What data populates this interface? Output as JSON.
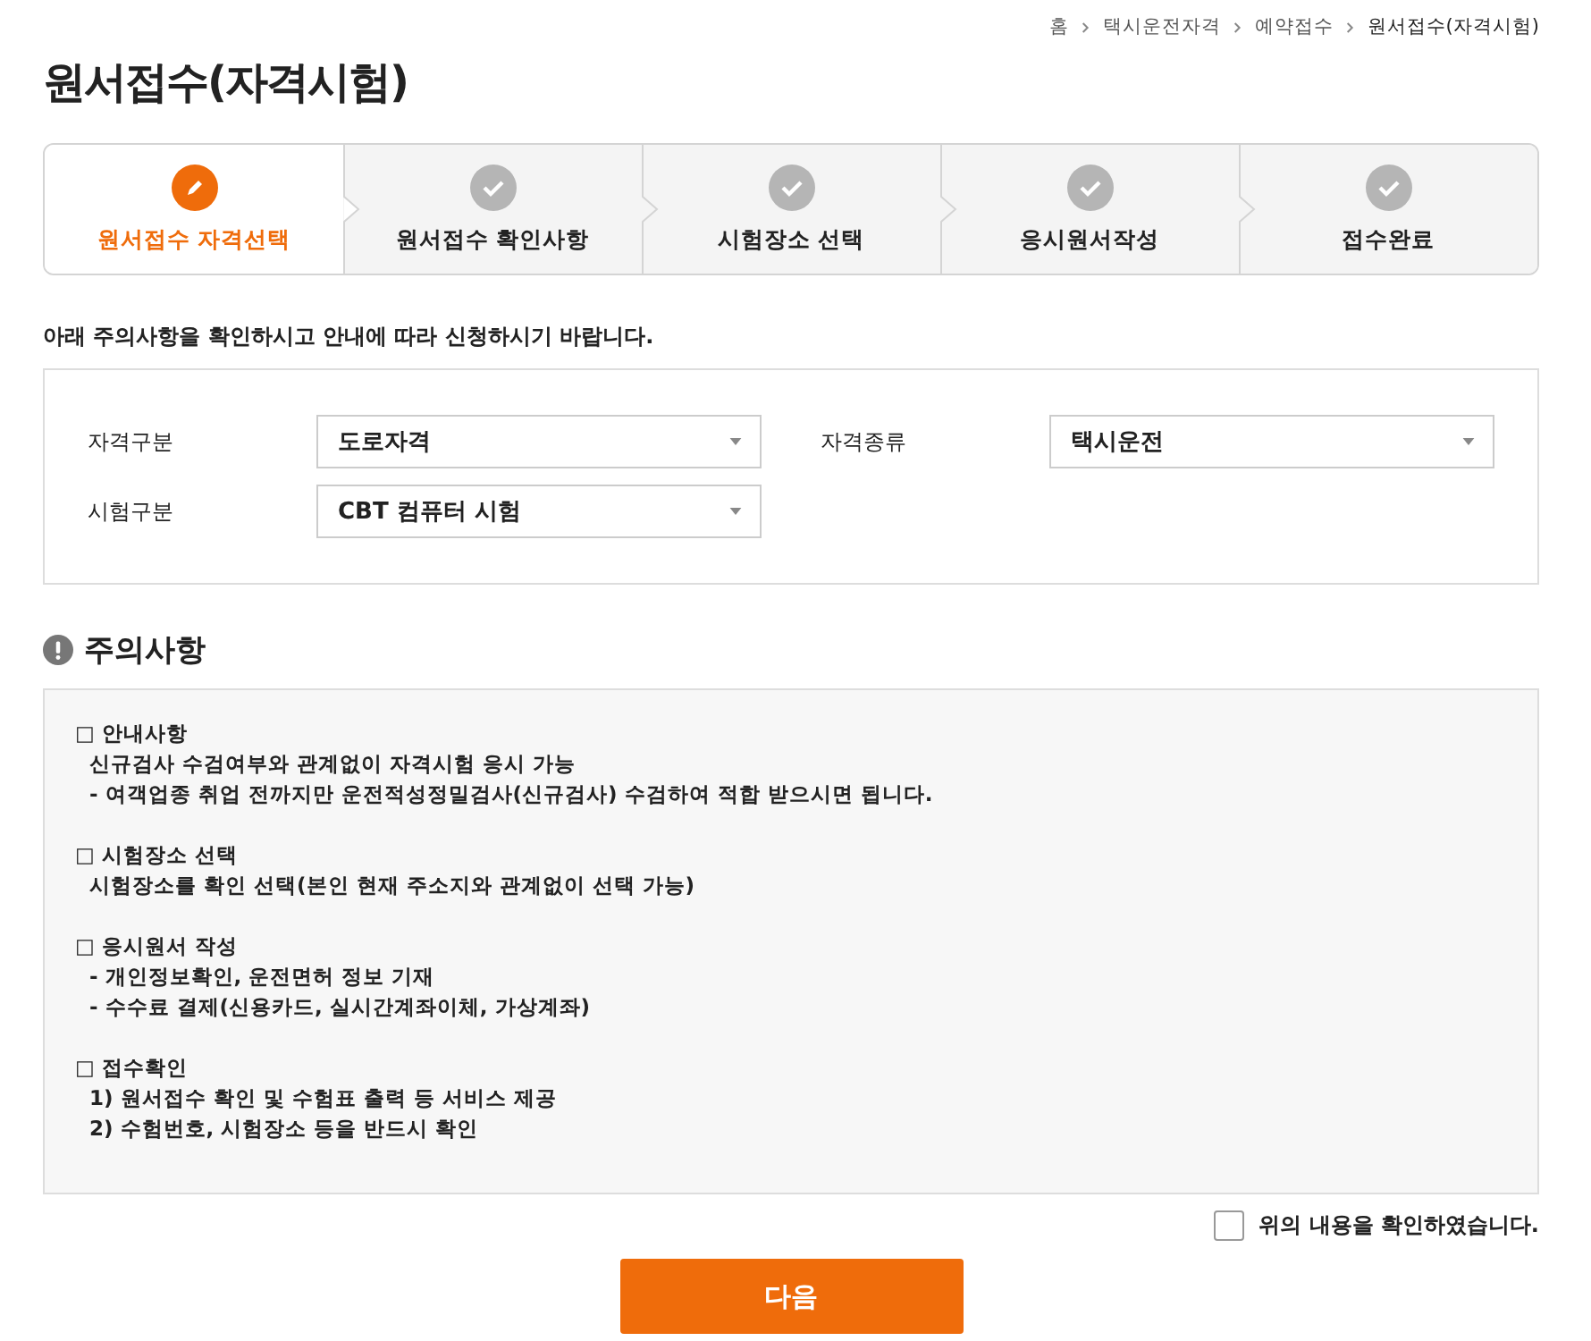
{
  "breadcrumb": [
    "홈",
    "택시운전자격",
    "예약접수",
    "원서접수(자격시험)"
  ],
  "title": "원서접수(자격시험)",
  "steps": [
    {
      "label": "원서접수 자격선택",
      "selected": true
    },
    {
      "label": "원서접수 확인사항",
      "selected": false
    },
    {
      "label": "시험장소 선택",
      "selected": false
    },
    {
      "label": "응시원서작성",
      "selected": false
    },
    {
      "label": "접수완료",
      "selected": false
    }
  ],
  "intro": "아래 주의사항을 확인하시고 안내에 따라 신청하시기 바랍니다.",
  "fields": [
    {
      "label": "자격구분",
      "value": "도로자격"
    },
    {
      "label": "자격종류",
      "value": "택시운전"
    },
    {
      "label": "시험구분",
      "value": "CBT 컴퓨터 시험"
    }
  ],
  "notice_title": "주의사항",
  "notices": [
    {
      "heading": "□ 안내사항",
      "lines": [
        "신규검사 수검여부와 관계없이 자격시험 응시 가능",
        "- 여객업종 취업 전까지만 운전적성정밀검사(신규검사) 수검하여 적합 받으시면 됩니다."
      ]
    },
    {
      "heading": "□ 시험장소 선택",
      "lines": [
        "시험장소를 확인 선택(본인 현재 주소지와 관계없이 선택 가능)"
      ]
    },
    {
      "heading": "□ 응시원서 작성",
      "lines": [
        "- 개인정보확인, 운전면허 정보 기재",
        "- 수수료 결제(신용카드, 실시간계좌이체, 가상계좌)"
      ]
    },
    {
      "heading": "□ 접수확인",
      "lines": [
        "1) 원서접수 확인 및 수험표 출력 등 서비스 제공",
        "2) 수험번호, 시험장소 등을 반드시 확인"
      ]
    }
  ],
  "confirm": {
    "label": "위의 내용을 확인하였습니다.",
    "checked": false
  },
  "next_button": "다음"
}
